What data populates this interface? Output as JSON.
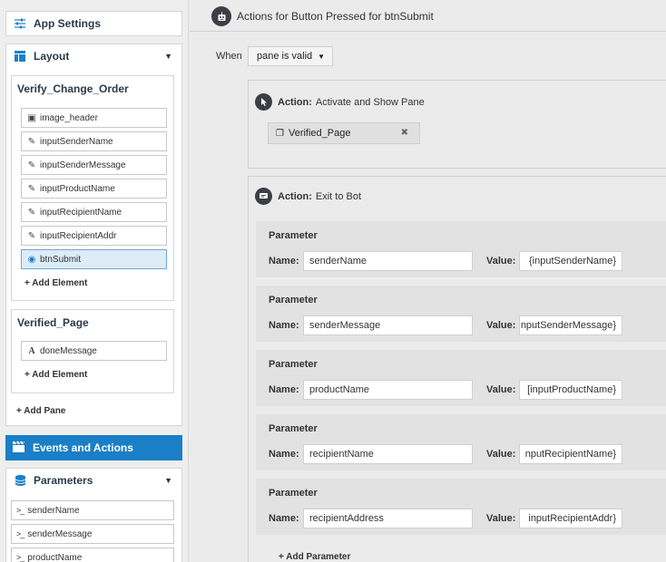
{
  "sidebar": {
    "app_settings_label": "App Settings",
    "layout_label": "Layout",
    "panes": [
      {
        "title": "Verify_Change_Order",
        "elements": [
          {
            "label": "image_header",
            "icon": "image-icon"
          },
          {
            "label": "inputSenderName",
            "icon": "edit-icon"
          },
          {
            "label": "inputSenderMessage",
            "icon": "edit-icon"
          },
          {
            "label": "inputProductName",
            "icon": "edit-icon"
          },
          {
            "label": "inputRecipientName",
            "icon": "edit-icon"
          },
          {
            "label": "inputRecipientAddr",
            "icon": "edit-icon"
          },
          {
            "label": "btnSubmit",
            "icon": "button-icon",
            "selected": true
          }
        ],
        "add_element_label": "+ Add Element"
      },
      {
        "title": "Verified_Page",
        "elements": [
          {
            "label": "doneMessage",
            "icon": "text-icon"
          }
        ],
        "add_element_label": "+ Add Element"
      }
    ],
    "add_pane_label": "+ Add Pane",
    "events_label": "Events and Actions",
    "parameters_label": "Parameters",
    "parameters": [
      "senderName",
      "senderMessage",
      "productName"
    ]
  },
  "main": {
    "header_title": "Actions for Button Pressed for btnSubmit",
    "when_label": "When",
    "when_value": "pane is valid",
    "action1": {
      "label": "Action:",
      "name": "Activate and Show Pane",
      "pane": "Verified_Page"
    },
    "action2": {
      "label": "Action:",
      "name": "Exit to Bot",
      "parameter_title": "Parameter",
      "name_label": "Name:",
      "value_label": "Value:",
      "parameters": [
        {
          "name": "senderName",
          "value": "{inputSenderName}"
        },
        {
          "name": "senderMessage",
          "value": "nputSenderMessage}"
        },
        {
          "name": "productName",
          "value": "[inputProductName}"
        },
        {
          "name": "recipientName",
          "value": "nputRecipientName}"
        },
        {
          "name": "recipientAddress",
          "value": "inputRecipientAddr}"
        }
      ],
      "add_parameter_label": "+ Add Parameter"
    }
  },
  "colors": {
    "accent": "#1a7fc7",
    "dark_icon": "#3b3f45",
    "selected_bg": "#dcecf8"
  }
}
